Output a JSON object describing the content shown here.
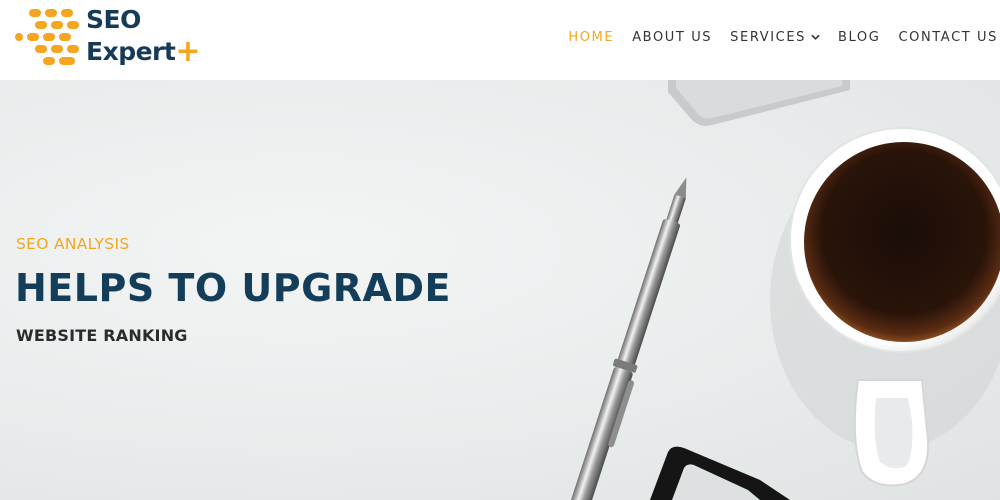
{
  "colors": {
    "brand_navy": "#153b56",
    "accent_orange": "#f4a623",
    "nav_text": "#333333",
    "hero_background": "#e9ecec"
  },
  "header": {
    "logo": {
      "icon": "logo-mark-icon",
      "line1": "SEO",
      "line2": "Expert",
      "plus": "+"
    },
    "nav": {
      "items": [
        {
          "label": "HOME",
          "active": true
        },
        {
          "label": "ABOUT US",
          "active": false
        },
        {
          "label": "SERVICES",
          "active": false,
          "icon": "chevron-down-icon"
        },
        {
          "label": "BLOG",
          "active": false
        },
        {
          "label": "CONTACT US",
          "active": false
        }
      ]
    }
  },
  "hero": {
    "eyebrow": "SEO ANALYSIS",
    "title": "HELPS TO UPGRADE",
    "subtitle": "WEBSITE RANKING",
    "background_image": "desk with coffee cup, pen and eyeglasses"
  }
}
